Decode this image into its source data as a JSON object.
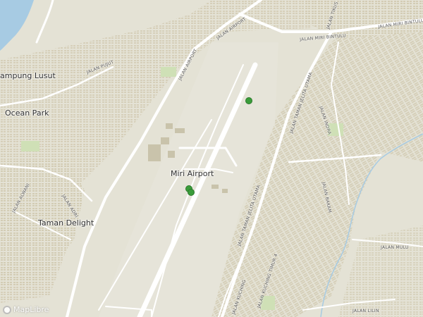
{
  "place_labels": {
    "kampung_lusut": "ampung Lusut",
    "ocean_park": "Ocean Park",
    "miri_airport": "Miri Airport",
    "taman_delight": "Taman Delight"
  },
  "road_labels": {
    "jalan_airport_1": "JALAN AIRPORT",
    "jalan_airport_2": "JALAN AIRPORT",
    "jalan_miri_bintulu": "JALAN MIRI BINTULU",
    "jalan_miri_bintulu_2": "JALAN MIRI BINTULU",
    "jalan_taman_jelita_utama": "JALAN TAMAN JELITA UTAMA",
    "jalan_taman_jelita_utama_2": "JALAN TAMAN JELITA UTAMA",
    "jalan_kuching": "JALAN KUCHING",
    "jalan_kuching_timur_4": "JALAN KUCHING TIMUR 4",
    "jalan_pujut": "JALAN PUJUT",
    "jalan_alwani": "JALAN ALWANI",
    "jalan_adri": "JALAN ADRI",
    "jalan_indra": "JALAN INDRA",
    "jalan_mulu": "JALAN MULU",
    "jalan_lilin": "JALAN LILIN",
    "jalan_bakam": "JALAN BAKAM",
    "jalan_tikus": "JALAN TIKUS"
  },
  "attribution": "MapLibre",
  "colors": {
    "land": "#e4e2d5",
    "water": "#a7cbe3",
    "road": "#ffffff",
    "building": "#d5cfb8",
    "park": "#cfe0b6",
    "marker": "#3a9c3a"
  },
  "markers": [
    {
      "name": "marker-north"
    },
    {
      "name": "marker-terminal-a"
    },
    {
      "name": "marker-terminal-b"
    }
  ]
}
